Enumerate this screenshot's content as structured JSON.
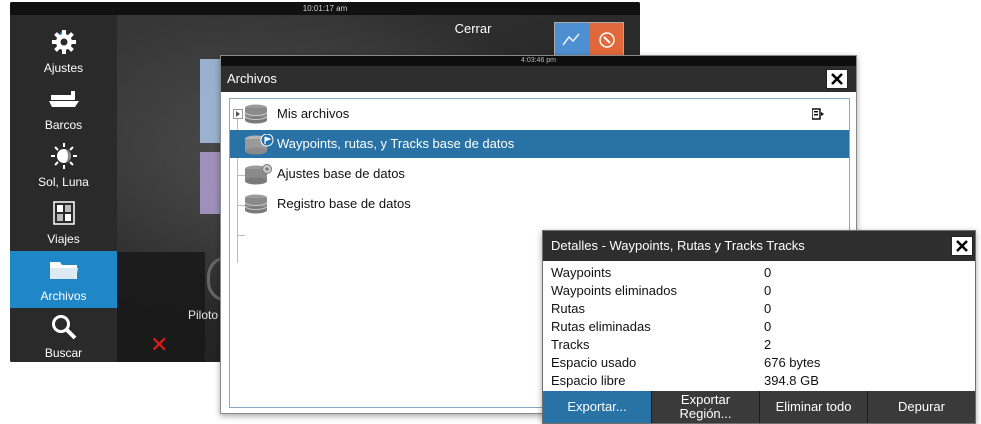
{
  "home": {
    "clock": "10:01:17 am",
    "close_label": "Cerrar",
    "autopilot_label": "Piloto",
    "sidebar": [
      {
        "label": "Ajustes",
        "icon": "gear-icon"
      },
      {
        "label": "Barcos",
        "icon": "ship-icon"
      },
      {
        "label": "Sol, Luna",
        "icon": "sun-moon-icon"
      },
      {
        "label": "Viajes",
        "icon": "trips-icon"
      },
      {
        "label": "Archivos",
        "icon": "folder-icon",
        "active": true
      },
      {
        "label": "Buscar",
        "icon": "search-icon"
      }
    ]
  },
  "files": {
    "clock": "4:03:46 pm",
    "title": "Archivos",
    "items": [
      {
        "label": "Mis archivos",
        "icon": "database-icon",
        "expandable": true
      },
      {
        "label": "Waypoints, rutas, y Tracks base de datos",
        "icon": "waypoint-database-icon",
        "selected": true
      },
      {
        "label": "Ajustes base de datos",
        "icon": "settings-database-icon"
      },
      {
        "label": "Registro base de datos",
        "icon": "database-icon"
      }
    ]
  },
  "details": {
    "title": "Detalles - Waypoints, Rutas y Tracks Tracks",
    "rows": [
      {
        "key": "Waypoints",
        "value": "0"
      },
      {
        "key": "Waypoints eliminados",
        "value": "0"
      },
      {
        "key": "Rutas",
        "value": "0"
      },
      {
        "key": "Rutas eliminadas",
        "value": "0"
      },
      {
        "key": "Tracks",
        "value": "2"
      },
      {
        "key": "Espacio usado",
        "value": "676 bytes"
      },
      {
        "key": "Espacio libre",
        "value": "394.8 GB"
      }
    ],
    "buttons": {
      "export": "Exportar...",
      "export_region_1": "Exportar",
      "export_region_2": "Región...",
      "delete_all": "Eliminar todo",
      "purge": "Depurar"
    }
  },
  "colors": {
    "accent": "#2872a5",
    "sidebar_active": "#1f86c8",
    "title_bar": "#2e2e2e",
    "error_red": "#e31b1b"
  }
}
